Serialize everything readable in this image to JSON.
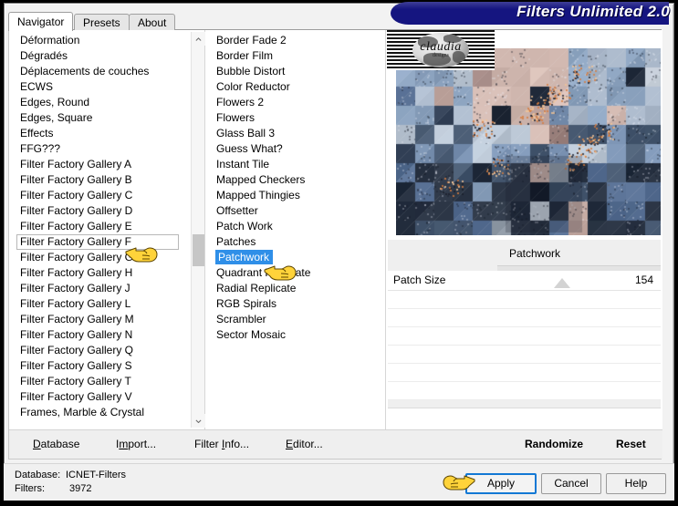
{
  "window": {
    "title": "Filters Unlimited 2.0"
  },
  "tabs": [
    {
      "label": "Navigator",
      "active": true
    },
    {
      "label": "Presets",
      "active": false
    },
    {
      "label": "About",
      "active": false
    }
  ],
  "navigator_list": {
    "items": [
      "Déformation",
      "Dégradés",
      "Déplacements de couches",
      "ECWS",
      "Edges, Round",
      "Edges, Square",
      "Effects",
      "FFG???",
      "Filter Factory Gallery A",
      "Filter Factory Gallery B",
      "Filter Factory Gallery C",
      "Filter Factory Gallery D",
      "Filter Factory Gallery E",
      "Filter Factory Gallery F",
      "Filter Factory Gallery G",
      "Filter Factory Gallery H",
      "Filter Factory Gallery J",
      "Filter Factory Gallery L",
      "Filter Factory Gallery M",
      "Filter Factory Gallery N",
      "Filter Factory Gallery Q",
      "Filter Factory Gallery S",
      "Filter Factory Gallery T",
      "Filter Factory Gallery V",
      "Frames, Marble & Crystal"
    ],
    "selected": "Filter Factory Gallery F"
  },
  "filter_list": {
    "items": [
      "Border Fade 2",
      "Border Film",
      "Bubble Distort",
      "Color Reductor",
      "Flowers 2",
      "Flowers",
      "Glass Ball 3",
      "Guess What?",
      "Instant Tile",
      "Mapped Checkers",
      "Mapped Thingies",
      "Offsetter",
      "Patch Work",
      "Patches",
      "Patchwork",
      "Quadrant Replicate",
      "Radial Replicate",
      "RGB Spirals",
      "Scrambler",
      "Sector Mosaic"
    ],
    "selected": "Patchwork"
  },
  "preview": {
    "filter_name": "Patchwork",
    "logo_word": "claudia",
    "logo_sub": "designs"
  },
  "parameters": [
    {
      "label": "Patch Size",
      "value": "154",
      "thumb_percent": 61
    }
  ],
  "toolbar_left": [
    {
      "label": "Database",
      "accel": "D"
    },
    {
      "label": "Import...",
      "accel": "I"
    },
    {
      "label": "Filter Info...",
      "accel": "I"
    },
    {
      "label": "Editor...",
      "accel": "E"
    }
  ],
  "toolbar_right": [
    {
      "label": "Randomize"
    },
    {
      "label": "Reset"
    }
  ],
  "status": {
    "database_label": "Database:",
    "database_value": "ICNET-Filters",
    "filters_label": "Filters:",
    "filters_value": "3972"
  },
  "dialog_buttons": [
    {
      "label": "Apply",
      "focused": true
    },
    {
      "label": "Cancel",
      "focused": false
    },
    {
      "label": "Help",
      "focused": false
    }
  ],
  "colors": {
    "title_banner": "#151580",
    "selection_blue": "#2f8fe8",
    "focus_border": "#1278d4",
    "hand_yellow": "#ffd33a"
  }
}
